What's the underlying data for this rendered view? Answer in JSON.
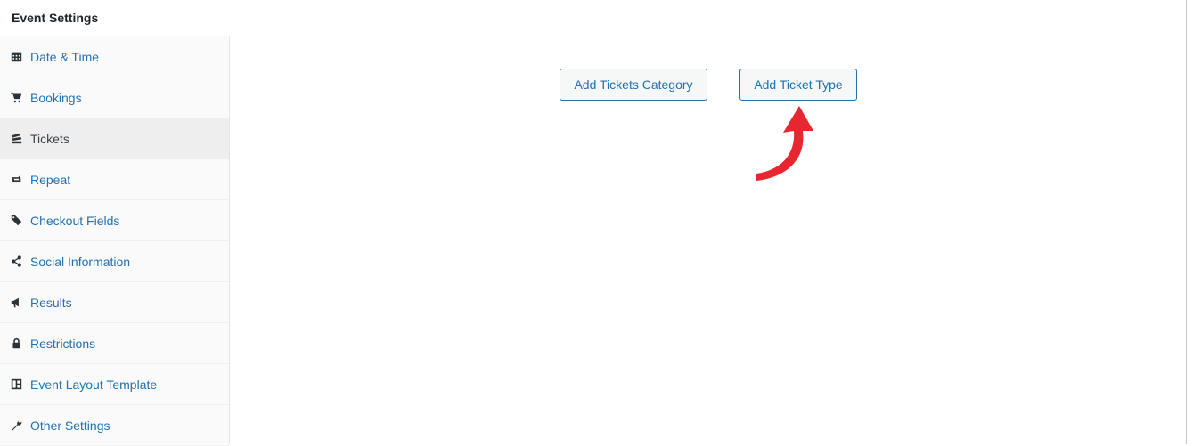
{
  "panel": {
    "title": "Event Settings"
  },
  "sidebar": {
    "items": [
      {
        "label": "Date & Time",
        "icon": "calendar-icon"
      },
      {
        "label": "Bookings",
        "icon": "cart-icon"
      },
      {
        "label": "Tickets",
        "icon": "tickets-icon",
        "active": true
      },
      {
        "label": "Repeat",
        "icon": "repeat-icon"
      },
      {
        "label": "Checkout Fields",
        "icon": "tag-icon"
      },
      {
        "label": "Social Information",
        "icon": "share-icon"
      },
      {
        "label": "Results",
        "icon": "megaphone-icon"
      },
      {
        "label": "Restrictions",
        "icon": "lock-icon"
      },
      {
        "label": "Event Layout Template",
        "icon": "layout-icon"
      },
      {
        "label": "Other Settings",
        "icon": "wrench-icon"
      }
    ]
  },
  "content": {
    "add_category_label": "Add Tickets Category",
    "add_type_label": "Add Ticket Type",
    "annotation_arrow_color": "#e8262f"
  }
}
